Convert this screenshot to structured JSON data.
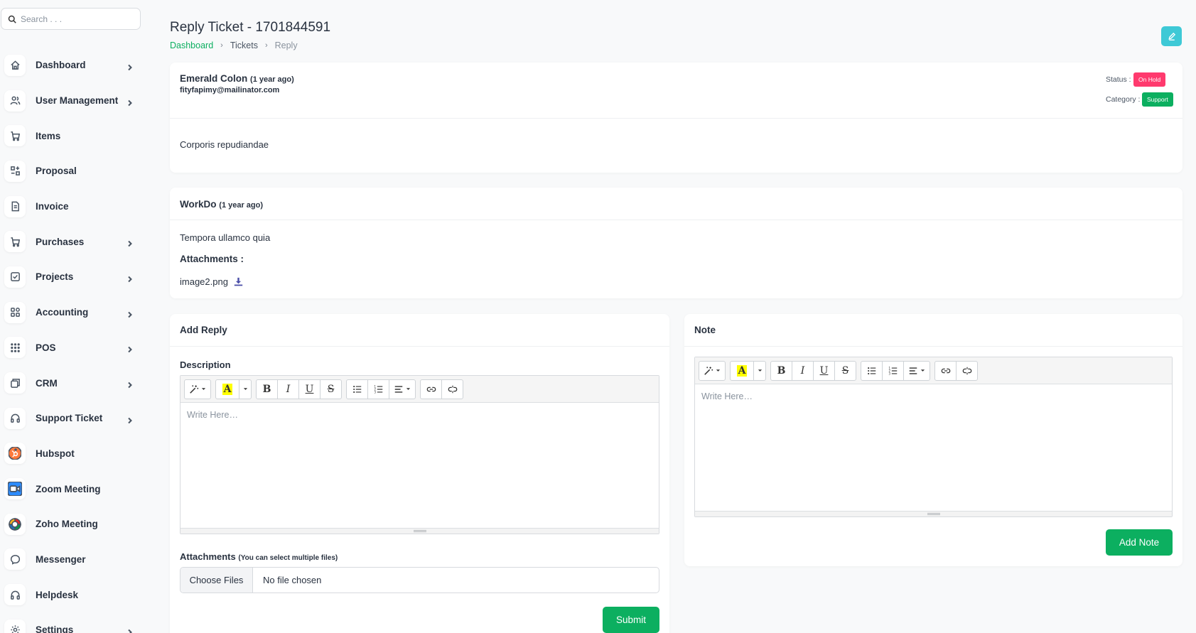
{
  "search": {
    "placeholder": "Search . . ."
  },
  "sidebar": {
    "items": [
      {
        "label": "Dashboard",
        "icon": "home-icon",
        "has_children": true
      },
      {
        "label": "User Management",
        "icon": "users-icon",
        "has_children": true
      },
      {
        "label": "Items",
        "icon": "cart-icon",
        "has_children": false
      },
      {
        "label": "Proposal",
        "icon": "proposal-icon",
        "has_children": false
      },
      {
        "label": "Invoice",
        "icon": "invoice-icon",
        "has_children": false
      },
      {
        "label": "Purchases",
        "icon": "cart-icon",
        "has_children": true
      },
      {
        "label": "Projects",
        "icon": "checkbox-icon",
        "has_children": true
      },
      {
        "label": "Accounting",
        "icon": "accounting-icon",
        "has_children": true
      },
      {
        "label": "POS",
        "icon": "grid-icon",
        "has_children": true
      },
      {
        "label": "CRM",
        "icon": "crm-icon",
        "has_children": true
      },
      {
        "label": "Support Ticket",
        "icon": "headphones-icon",
        "has_children": true
      },
      {
        "label": "Hubspot",
        "icon": "hubspot-icon",
        "has_children": false
      },
      {
        "label": "Zoom Meeting",
        "icon": "zoom-icon",
        "has_children": false
      },
      {
        "label": "Zoho Meeting",
        "icon": "zoho-icon",
        "has_children": false
      },
      {
        "label": "Messenger",
        "icon": "messenger-icon",
        "has_children": false
      },
      {
        "label": "Helpdesk",
        "icon": "headphones-icon",
        "has_children": false
      },
      {
        "label": "Settings",
        "icon": "gear-icon",
        "has_children": true
      }
    ]
  },
  "header": {
    "title": "Reply Ticket - 1701844591",
    "breadcrumb": [
      "Dashboard",
      "Tickets",
      "Reply"
    ]
  },
  "ticket": {
    "name": "Emerald Colon",
    "ago": "(1 year ago)",
    "email": "fityfapimy@mailinator.com",
    "status_label": "Status :",
    "status": "On Hold",
    "category_label": "Category :",
    "category": "Support",
    "body": "Corporis repudiandae"
  },
  "reply": {
    "name": "WorkDo",
    "ago": "(1 year ago)",
    "body": "Tempora ullamco quia",
    "attachments_title": "Attachments :",
    "file": "image2.png"
  },
  "add_reply": {
    "title": "Add Reply",
    "description_label": "Description",
    "editor_placeholder": "Write Here…",
    "attachments_label": "Attachments",
    "attachments_hint": "(You can select multiple files)",
    "choose_files": "Choose Files",
    "no_file": "No file chosen",
    "submit": "Submit"
  },
  "note": {
    "title": "Note",
    "editor_placeholder": "Write Here…",
    "add_note": "Add Note"
  },
  "colors": {
    "accent": "#0caf60",
    "status_on_hold": "#ff3a6e",
    "edit_button": "#3ec9d6"
  }
}
